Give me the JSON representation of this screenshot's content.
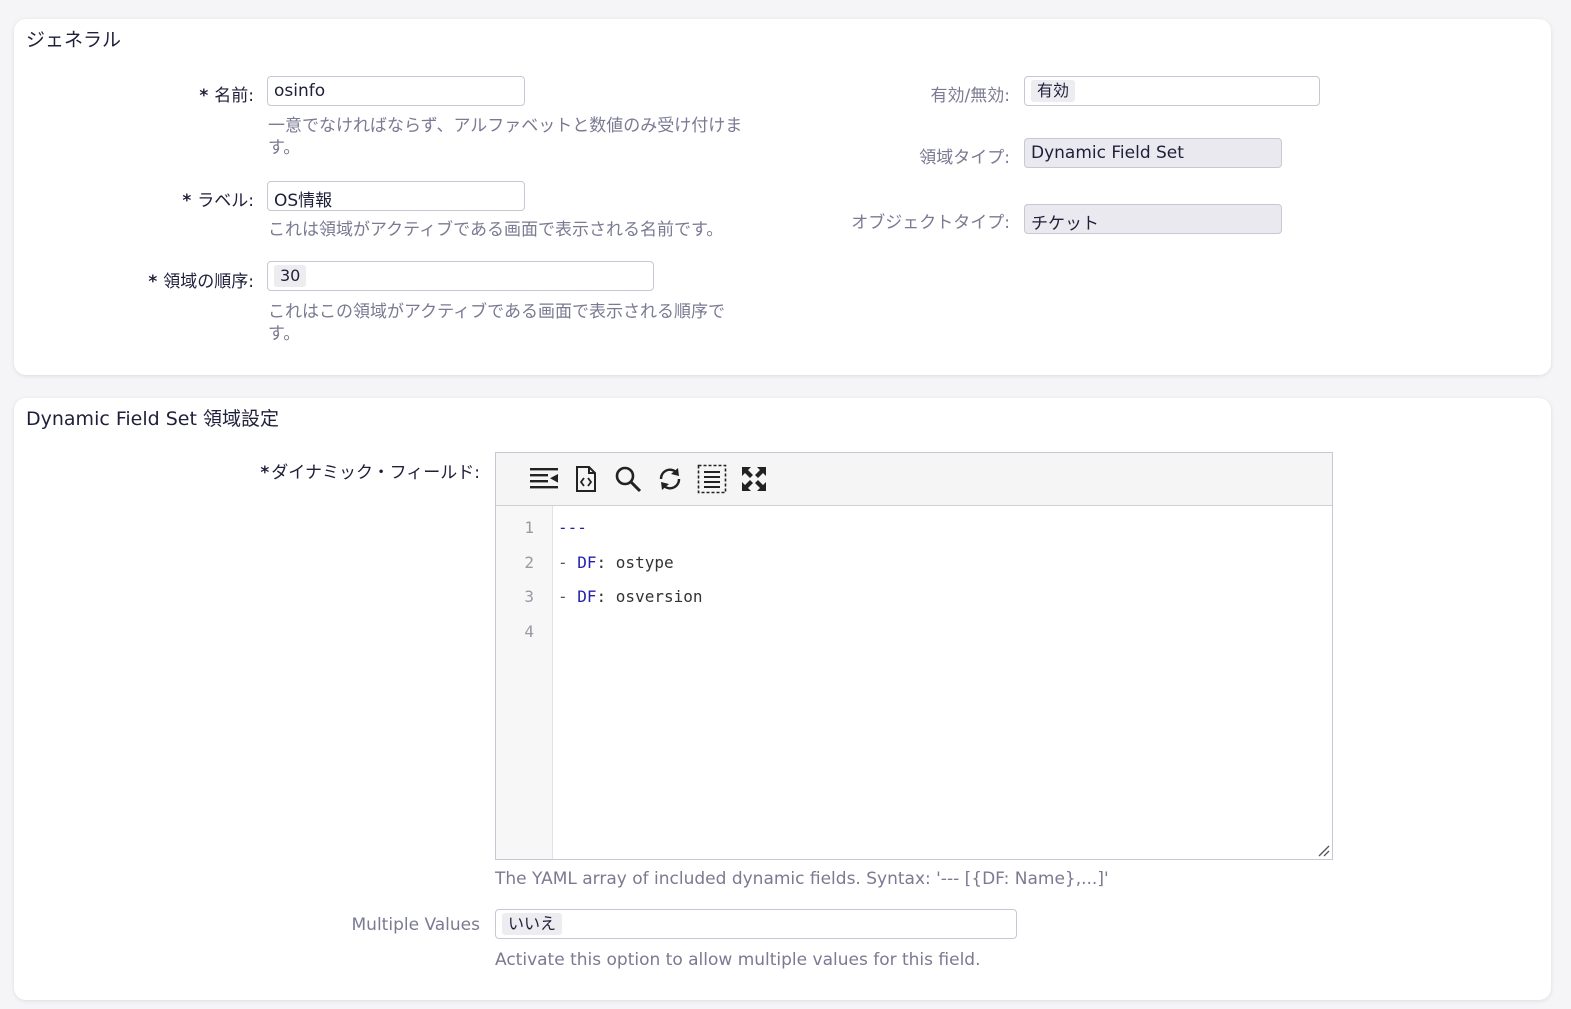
{
  "general": {
    "title": "ジェネラル",
    "name": {
      "label": "名前:",
      "value": "osinfo",
      "help": "一意でなければならず、アルファベットと数値のみ受け付けま",
      "help2": "す。"
    },
    "label_field": {
      "label": "ラベル:",
      "value": "OS情報",
      "help": "これは領域がアクティブである画面で表示される名前です。"
    },
    "order": {
      "label": "領域の順序:",
      "value": "30",
      "help": "これはこの領域がアクティブである画面で表示される順序で",
      "help2": "す。"
    },
    "validity": {
      "label": "有効/無効:",
      "value": "有効"
    },
    "field_type": {
      "label": "領域タイプ:",
      "value": "Dynamic Field Set"
    },
    "object_type": {
      "label": "オブジェクトタイプ:",
      "value": "チケット"
    },
    "required_marker": "*"
  },
  "dfs": {
    "title": "Dynamic Field Set 領域設定",
    "dynamic_fields": {
      "label": "ダイナミック・フィールド:",
      "help": "The YAML array of included dynamic fields. Syntax: '--- [{DF: Name},...]'",
      "toolbar": [
        "indent-icon",
        "code-file-icon",
        "search-icon",
        "replace-icon",
        "select-all-icon",
        "fullscreen-icon"
      ],
      "lines": [
        {
          "num": "1",
          "dash": "---",
          "key": "",
          "rest": ""
        },
        {
          "num": "2",
          "dash": "- ",
          "key": "DF",
          "rest": ": ostype"
        },
        {
          "num": "3",
          "dash": "- ",
          "key": "DF",
          "rest": ": osversion"
        },
        {
          "num": "4",
          "dash": "",
          "key": "",
          "rest": ""
        }
      ]
    },
    "multiple_values": {
      "label": "Multiple Values",
      "value": "いいえ",
      "help": "Activate this option to allow multiple values for this field."
    }
  },
  "colors": {
    "text": "#1f1f3a",
    "muted": "#7a7a92",
    "yaml_key": "#2222aa",
    "background": "#f5f5f7"
  }
}
